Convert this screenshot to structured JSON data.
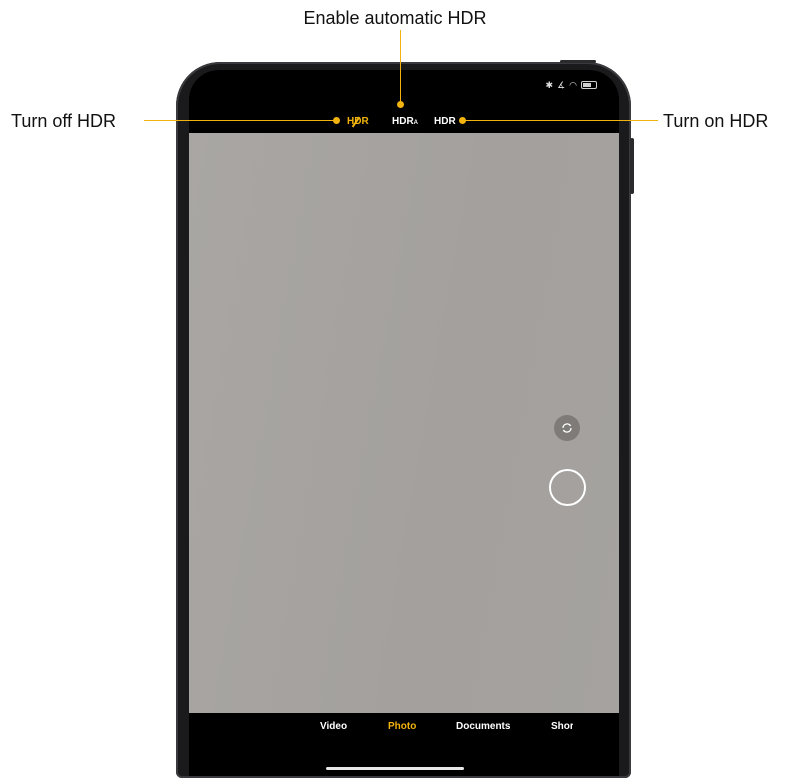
{
  "annotations": {
    "auto": "Enable automatic HDR",
    "off": "Turn off HDR",
    "on": "Turn on HDR",
    "accent": "#F2B30E"
  },
  "camera": {
    "hdr_off_label": "HDR",
    "hdr_auto_label": "HDR",
    "hdr_auto_sub": "A",
    "hdr_on_label": "HDR",
    "modes": [
      "Video",
      "Photo",
      "Documents",
      "Shor"
    ],
    "active_mode": "Photo",
    "icons": [
      "bluetooth-icon",
      "signal-icon",
      "wifi-icon",
      "battery-icon",
      "switch-camera-icon",
      "shutter-icon"
    ]
  }
}
